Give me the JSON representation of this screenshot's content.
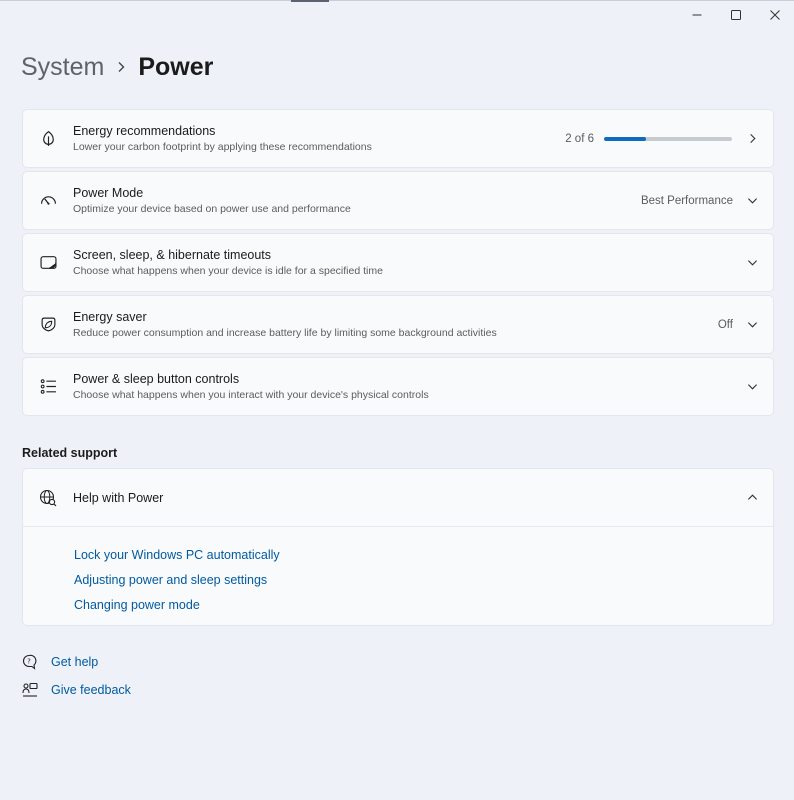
{
  "window": {
    "minimize_icon": "minimize-icon",
    "maximize_icon": "maximize-icon",
    "close_icon": "close-icon"
  },
  "breadcrumb": {
    "parent": "System",
    "separator_icon": "chevron-right-icon",
    "current": "Power"
  },
  "cards": [
    {
      "icon": "leaf-icon",
      "title": "Energy recommendations",
      "description": "Lower your carbon footprint by applying these recommendations",
      "value": "2 of 6",
      "progress": 0.33,
      "accent": "#0f6cbd",
      "chevron": "chevron-right-icon"
    },
    {
      "icon": "speedometer-icon",
      "title": "Power Mode",
      "description": "Optimize your device based on power use and performance",
      "value": "Best Performance",
      "chevron": "chevron-down-icon"
    },
    {
      "icon": "screen-sleep-icon",
      "title": "Screen, sleep, & hibernate timeouts",
      "description": "Choose what happens when your device is idle for a specified time",
      "value": "",
      "chevron": "chevron-down-icon"
    },
    {
      "icon": "energy-saver-icon",
      "title": "Energy saver",
      "description": "Reduce power consumption and increase battery life by limiting some background activities",
      "value": "Off",
      "chevron": "chevron-down-icon"
    },
    {
      "icon": "button-controls-icon",
      "title": "Power & sleep button controls",
      "description": "Choose what happens when you interact with your device's physical controls",
      "value": "",
      "chevron": "chevron-down-icon"
    }
  ],
  "related_support": {
    "heading": "Related support",
    "help": {
      "icon": "globe-search-icon",
      "title": "Help with Power",
      "chevron": "chevron-up-icon",
      "links": [
        "Lock your Windows PC automatically",
        "Adjusting power and sleep settings",
        "Changing power mode"
      ]
    }
  },
  "footer": {
    "get_help": {
      "icon": "get-help-icon",
      "label": "Get help"
    },
    "give_feedback": {
      "icon": "feedback-icon",
      "label": "Give feedback"
    }
  },
  "colors": {
    "background": "#eef2f8",
    "card": "#f9fafc",
    "link": "#005a9e",
    "accent": "#0f6cbd"
  }
}
